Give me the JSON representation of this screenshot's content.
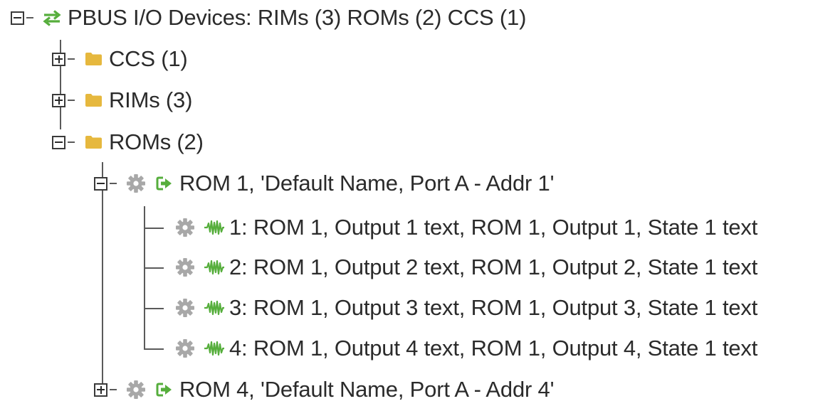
{
  "tree": {
    "root": {
      "label": "PBUS I/O Devices: RIMs (3) ROMs (2) CCS (1)",
      "icon": "transfer-arrows-icon",
      "expanded": true
    },
    "folders": [
      {
        "label": "CCS (1)",
        "icon": "folder-icon",
        "expanded": false
      },
      {
        "label": "RIMs (3)",
        "icon": "folder-icon",
        "expanded": false
      },
      {
        "label": "ROMs (2)",
        "icon": "folder-icon",
        "expanded": true
      }
    ],
    "roms": [
      {
        "label": "ROM 1, 'Default Name, Port A - Addr 1'",
        "expanded": true,
        "outputs": [
          {
            "label": "1: ROM 1, Output 1 text, ROM 1, Output 1, State 1 text"
          },
          {
            "label": "2: ROM 1, Output 2 text, ROM 1, Output 2, State 1 text"
          },
          {
            "label": "3: ROM 1, Output 3 text, ROM 1, Output 3, State 1 text"
          },
          {
            "label": "4: ROM 1, Output 4 text, ROM 1, Output 4, State 1 text"
          }
        ]
      },
      {
        "label": "ROM 4, 'Default Name, Port A - Addr 4'",
        "expanded": false
      }
    ]
  },
  "colors": {
    "accent_green": "#56ae3c",
    "folder": "#e6b83e",
    "gear": "#a8a8a8",
    "line": "#5a5a5a"
  }
}
